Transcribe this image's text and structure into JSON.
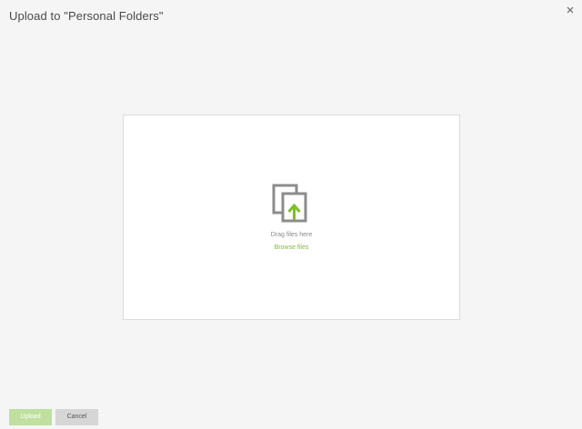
{
  "dialog": {
    "title": "Upload to \"Personal Folders\"",
    "close_icon": "close-icon"
  },
  "dropzone": {
    "icon": "upload-files-icon",
    "drag_text": "Drag files here",
    "browse_label": "Browse files"
  },
  "footer": {
    "upload_label": "Upload",
    "cancel_label": "Cancel"
  },
  "colors": {
    "accent": "#7bbf2a",
    "upload_disabled_bg": "#bfe0a0",
    "cancel_bg": "#d6d6d6",
    "icon_gray": "#8c8c8c"
  }
}
